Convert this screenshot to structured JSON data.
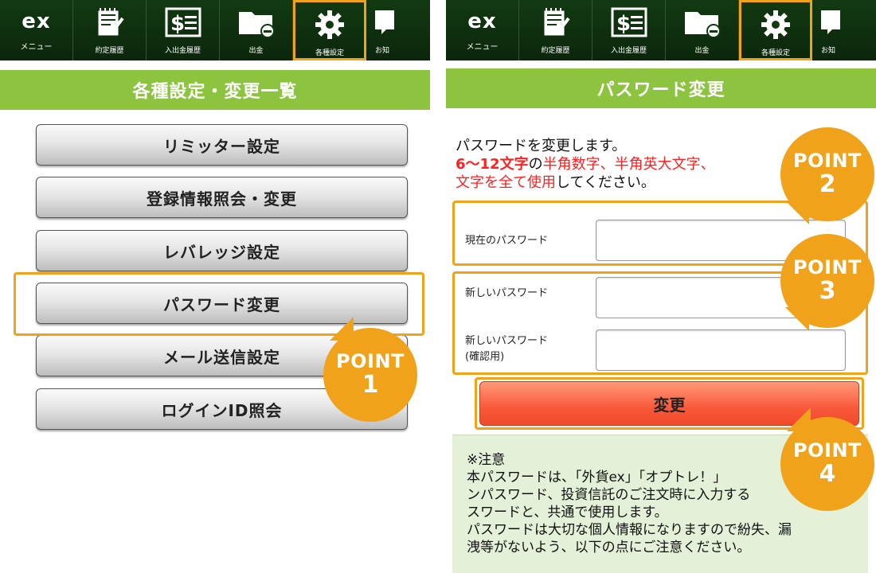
{
  "nav": {
    "items": [
      {
        "label": "メニュー",
        "logo": "ex",
        "icon": "ex-logo-icon"
      },
      {
        "label": "約定履歴",
        "icon": "notepad-check-icon"
      },
      {
        "label": "入出金履歴",
        "icon": "dollar-document-icon"
      },
      {
        "label": "出金",
        "icon": "folder-withdraw-icon"
      },
      {
        "label": "各種設定",
        "icon": "gear-icon"
      },
      {
        "label": "お知",
        "icon": "notice-icon"
      }
    ],
    "active_index": 4
  },
  "left": {
    "title": "各種設定・変更一覧",
    "buttons": [
      "リミッター設定",
      "登録情報照会・変更",
      "レバレッジ設定",
      "パスワード変更",
      "メール送信設定",
      "ログインID照会"
    ],
    "highlighted_index": 3
  },
  "right": {
    "title": "パスワード変更",
    "intro": {
      "line1": "パスワードを変更します。",
      "line2_bold": "6～12文字",
      "line2_normal": "の",
      "line2_red": "半角数字、半角英大文字、",
      "line3_red": "文字を全て使用",
      "line3_normal": "してください。"
    },
    "fields": {
      "current_label": "現在のパスワード",
      "new_label": "新しいパスワード",
      "confirm_label_1": "新しいパスワード",
      "confirm_label_2": "(確認用)"
    },
    "submit_label": "変更",
    "notice": {
      "lines": [
        "※注意",
        "本パスワードは、「外貨ex」「オプトレ！」",
        "ンパスワード、投資信託のご注文時に入力する",
        "スワードと、共通で使用します。",
        "パスワードは大切な個人情報になりますので紛失、漏",
        "洩等がないよう、以下の点にご注意ください。"
      ]
    }
  },
  "points": [
    {
      "word": "POINT",
      "number": "1"
    },
    {
      "word": "POINT",
      "number": "2"
    },
    {
      "word": "POINT",
      "number": "3"
    },
    {
      "word": "POINT",
      "number": "4"
    }
  ],
  "colors": {
    "nav_bg": "#0b260b",
    "title_green": "#8cc43f",
    "accent_orange": "#f0a21a",
    "submit_red": "#f8593a",
    "notice_bg": "#e4f0d7",
    "red_text": "#ff2020"
  }
}
